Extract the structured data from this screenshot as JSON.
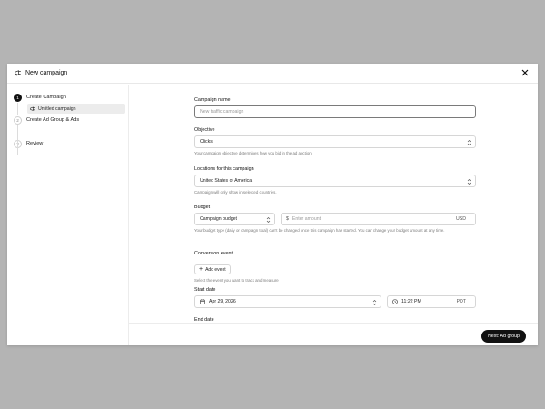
{
  "header": {
    "title": "New campaign"
  },
  "sidebar": {
    "steps": [
      {
        "num": "1",
        "label": "Create Campaign"
      },
      {
        "num": "2",
        "label": "Create Ad Group & Ads"
      },
      {
        "num": "3",
        "label": "Review"
      }
    ],
    "substep_label": "Untitled campaign"
  },
  "form": {
    "campaign_name": {
      "label": "Campaign name",
      "placeholder": "New traffic campaign"
    },
    "objective": {
      "label": "Objective",
      "value": "Clicks",
      "help": "Your campaign objective determines how you bid in the ad auction."
    },
    "locations": {
      "label": "Locations for this campaign",
      "value": "United States of America",
      "help": "Campaign will only show in selected countries."
    },
    "budget": {
      "label": "Budget",
      "type_value": "Campaign budget",
      "currency_symbol": "$",
      "amount_placeholder": "Enter amount",
      "currency": "USD",
      "help": "Your budget type (daily or campaign total) can't be changed once this campaign has started. You can change your budget amount at any time."
    },
    "conversion": {
      "label": "Conversion event",
      "button": "Add event",
      "help": "Select the event you want to track and measure"
    },
    "start_date": {
      "label": "Start date",
      "date": "Apr 29, 2026",
      "time": "11:22 PM",
      "tz": "PDT"
    },
    "end_date": {
      "label": "End date"
    }
  },
  "footer": {
    "next_label": "Next: Ad group"
  }
}
